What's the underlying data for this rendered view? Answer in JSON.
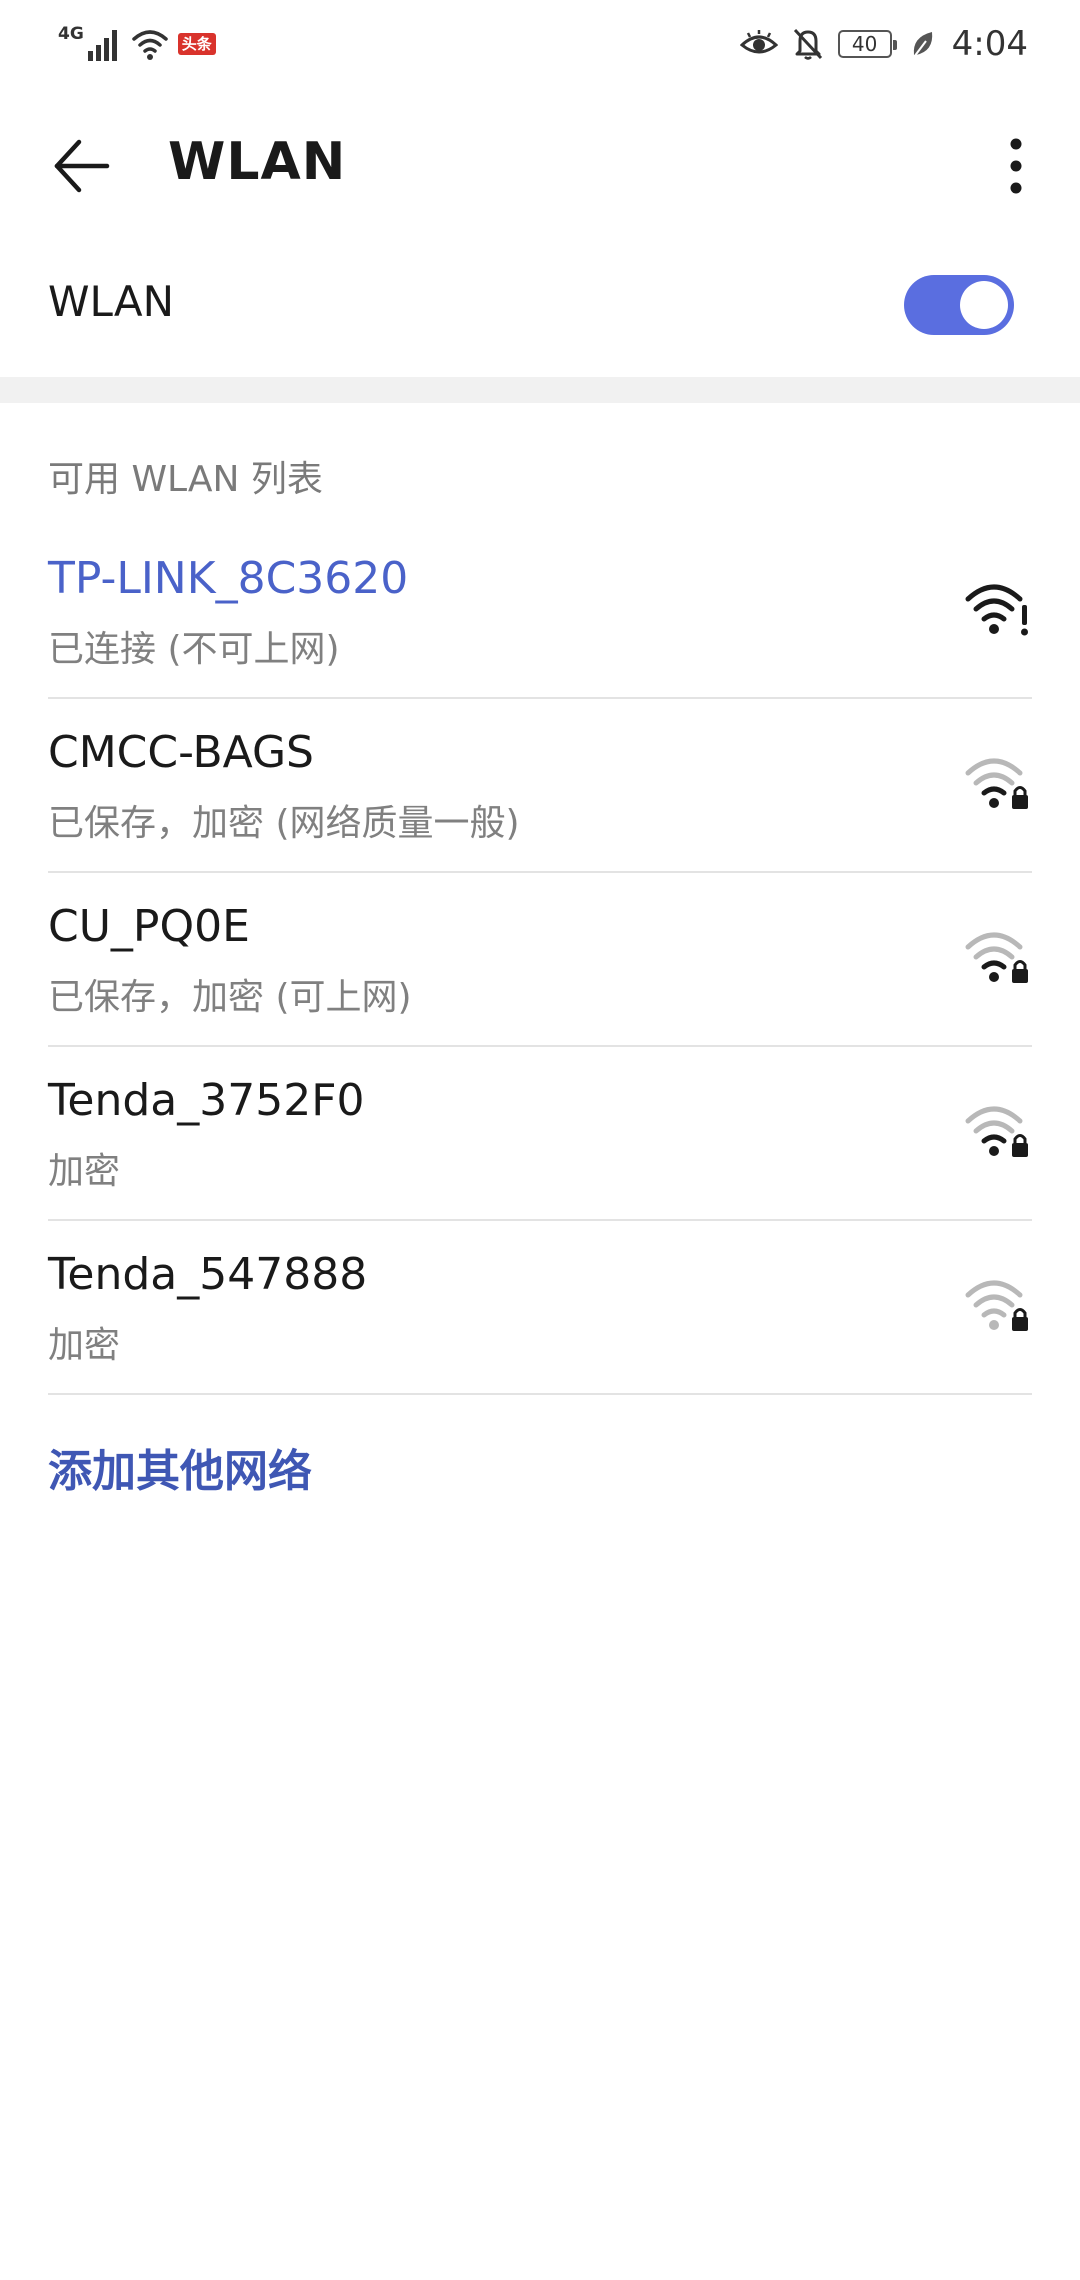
{
  "status_bar": {
    "network_type": "4G",
    "app_badge": "头条",
    "battery_level": "40",
    "time": "4:04",
    "icons": [
      "signal-icon",
      "wifi-icon",
      "eye-comfort-icon",
      "bell-off-icon",
      "battery-icon",
      "leaf-icon"
    ]
  },
  "app_bar": {
    "title": "WLAN",
    "back_icon": "arrow-left-icon",
    "menu_icon": "more-vertical-icon"
  },
  "wlan_toggle": {
    "label": "WLAN",
    "enabled": true,
    "accent_color": "#5a6ee0"
  },
  "section": {
    "header": "可用 WLAN 列表"
  },
  "networks": [
    {
      "name": "TP-LINK_8C3620",
      "status": "已连接 (不可上网)",
      "connected": true,
      "signal": 4,
      "locked": false,
      "warning": true
    },
    {
      "name": "CMCC-BAGS",
      "status": "已保存，加密 (网络质量一般)",
      "connected": false,
      "signal": 2,
      "locked": true
    },
    {
      "name": "CU_PQ0E",
      "status": "已保存，加密 (可上网)",
      "connected": false,
      "signal": 2,
      "locked": true
    },
    {
      "name": "Tenda_3752F0",
      "status": "加密",
      "connected": false,
      "signal": 2,
      "locked": true
    },
    {
      "name": "Tenda_547888",
      "status": "加密",
      "connected": false,
      "signal": 1,
      "locked": true
    }
  ],
  "add_network": {
    "label": "添加其他网络"
  },
  "colors": {
    "connected_text": "#4a62c9",
    "link_text": "#3f57b4",
    "secondary_text": "#808080"
  }
}
